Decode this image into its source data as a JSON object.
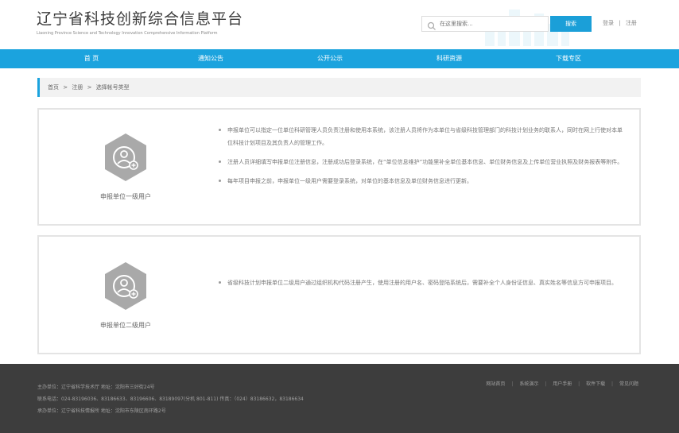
{
  "header": {
    "title": "辽宁省科技创新综合信息平台",
    "subtitle": "Liaoning Province Science and Technology Innovation Comprehensive Information Platform",
    "search_placeholder": "在这里搜索...",
    "search_button": "搜索",
    "login": "登录",
    "separator": "|",
    "register": "注册"
  },
  "nav": {
    "items": [
      "首 页",
      "通知公告",
      "公开公示",
      "科研资源",
      "下载专区"
    ]
  },
  "breadcrumb": {
    "home": "首页",
    "sep1": ">",
    "register": "注册",
    "sep2": ">",
    "current": "选择帐号类型"
  },
  "cards": [
    {
      "label": "申报单位一级用户",
      "bullets": [
        "申报单位可以指定一位单位科研管理人员负责注册和使用本系统，该注册人员将作为本单位与省级科技管理部门的科技计划业务的联系人，同时在网上行使对本单位科技计划项目及其负责人的管理工作。",
        "注册人员详细填写申报单位注册信息，注册成功后登录系统，在“单位信息维护”功能里补全单位基本信息、单位财务信息及上传单位营业执照及财务报表等附件。",
        "每年项目申报之前，申报单位一级用户需要登录系统，对单位的基本信息及单位财务信息进行更新。"
      ]
    },
    {
      "label": "申报单位二级用户",
      "bullets": [
        "省级科技计划申报单位二级用户通过组织机构代码注册产生，使用注册的用户名、密码登陆系统后，需要补全个人身份证信息、真实姓名等信息方可申报项目。"
      ]
    }
  ],
  "footer": {
    "lines": [
      "主办单位：辽宁省科学技术厅 地址：沈阳市三好街24号",
      "联系电话：024-83196036、83186633、83196606、83189097(分机 801-811) 传真：（024）83186632，83186634",
      "承办单位：辽宁省科技情报所 地址：沈阳市东陵区南环路2号"
    ],
    "links": [
      "网站首页",
      "系统演示",
      "用户手册",
      "软件下载",
      "常见问题"
    ],
    "link_sep": "|"
  },
  "colors": {
    "accent": "#1ba3de",
    "footer_bg": "#3d3d3d",
    "icon_gray": "#a9a9a9"
  }
}
